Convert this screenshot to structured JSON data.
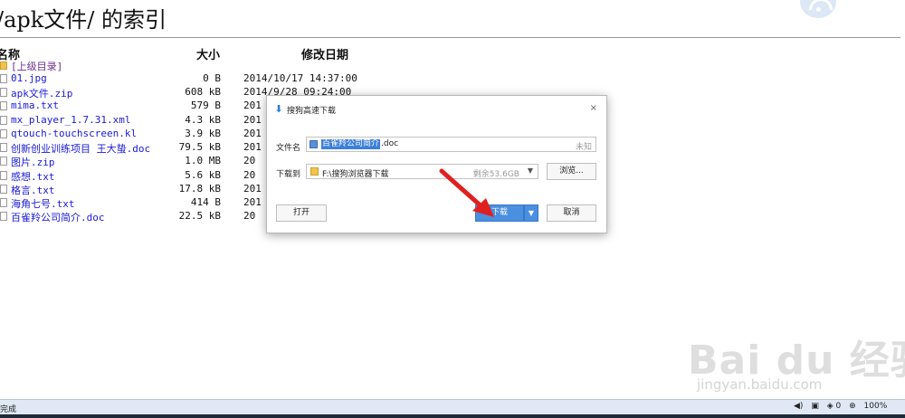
{
  "page": {
    "title": "/apk文件/ 的索引"
  },
  "table": {
    "headers": {
      "name": "名称",
      "size": "大小",
      "date": "修改日期"
    },
    "rows": [
      {
        "name": "[上级目录]",
        "size": "",
        "date": "",
        "type": "parent"
      },
      {
        "name": "01.jpg",
        "size": "0 B",
        "date": "2014/10/17 14:37:00",
        "type": "file"
      },
      {
        "name": "apk文件.zip",
        "size": "608 kB",
        "date": "2014/9/28 09:24:00",
        "type": "file"
      },
      {
        "name": "mima.txt",
        "size": "579 B",
        "date": "201",
        "type": "file"
      },
      {
        "name": "mx_player_1.7.31.xml",
        "size": "4.3 kB",
        "date": "201",
        "type": "file"
      },
      {
        "name": "qtouch-touchscreen.kl",
        "size": "3.9 kB",
        "date": "201",
        "type": "file"
      },
      {
        "name": "创新创业训练项目 王大蛰.doc",
        "size": "79.5 kB",
        "date": "201",
        "type": "file"
      },
      {
        "name": "图片.zip",
        "size": "1.0 MB",
        "date": "20",
        "type": "file"
      },
      {
        "name": "感想.txt",
        "size": "5.6 kB",
        "date": "20",
        "type": "file"
      },
      {
        "name": "格言.txt",
        "size": "17.8 kB",
        "date": "201",
        "type": "file"
      },
      {
        "name": "海角七号.txt",
        "size": "414 B",
        "date": "201",
        "type": "file"
      },
      {
        "name": "百雀羚公司简介.doc",
        "size": "22.5 kB",
        "date": "20",
        "type": "file"
      }
    ]
  },
  "dialog": {
    "title": "搜狗高速下载",
    "close": "×",
    "filename_label": "文件名",
    "filename_selected": "百雀羚公司简介",
    "filename_ext": ".doc",
    "filesize": "未知",
    "saveto_label": "下载到",
    "path": "F:\\搜狗浏览器下载",
    "free_space": "剩余53.6GB",
    "browse_button": "浏览...",
    "open_button": "打开",
    "download_button": "下载",
    "download_arrow": "▼",
    "cancel_button": "取消"
  },
  "statusbar": {
    "left": "完成",
    "zoom": "100%"
  },
  "watermark": {
    "brand": "Bai du 经验",
    "url": "jingyan.baidu.com"
  },
  "colors": {
    "link": "#1a1ad6",
    "parent_link": "#6b2c8e",
    "download_button": "#4a8fe0",
    "annotation_arrow": "#e02020"
  }
}
